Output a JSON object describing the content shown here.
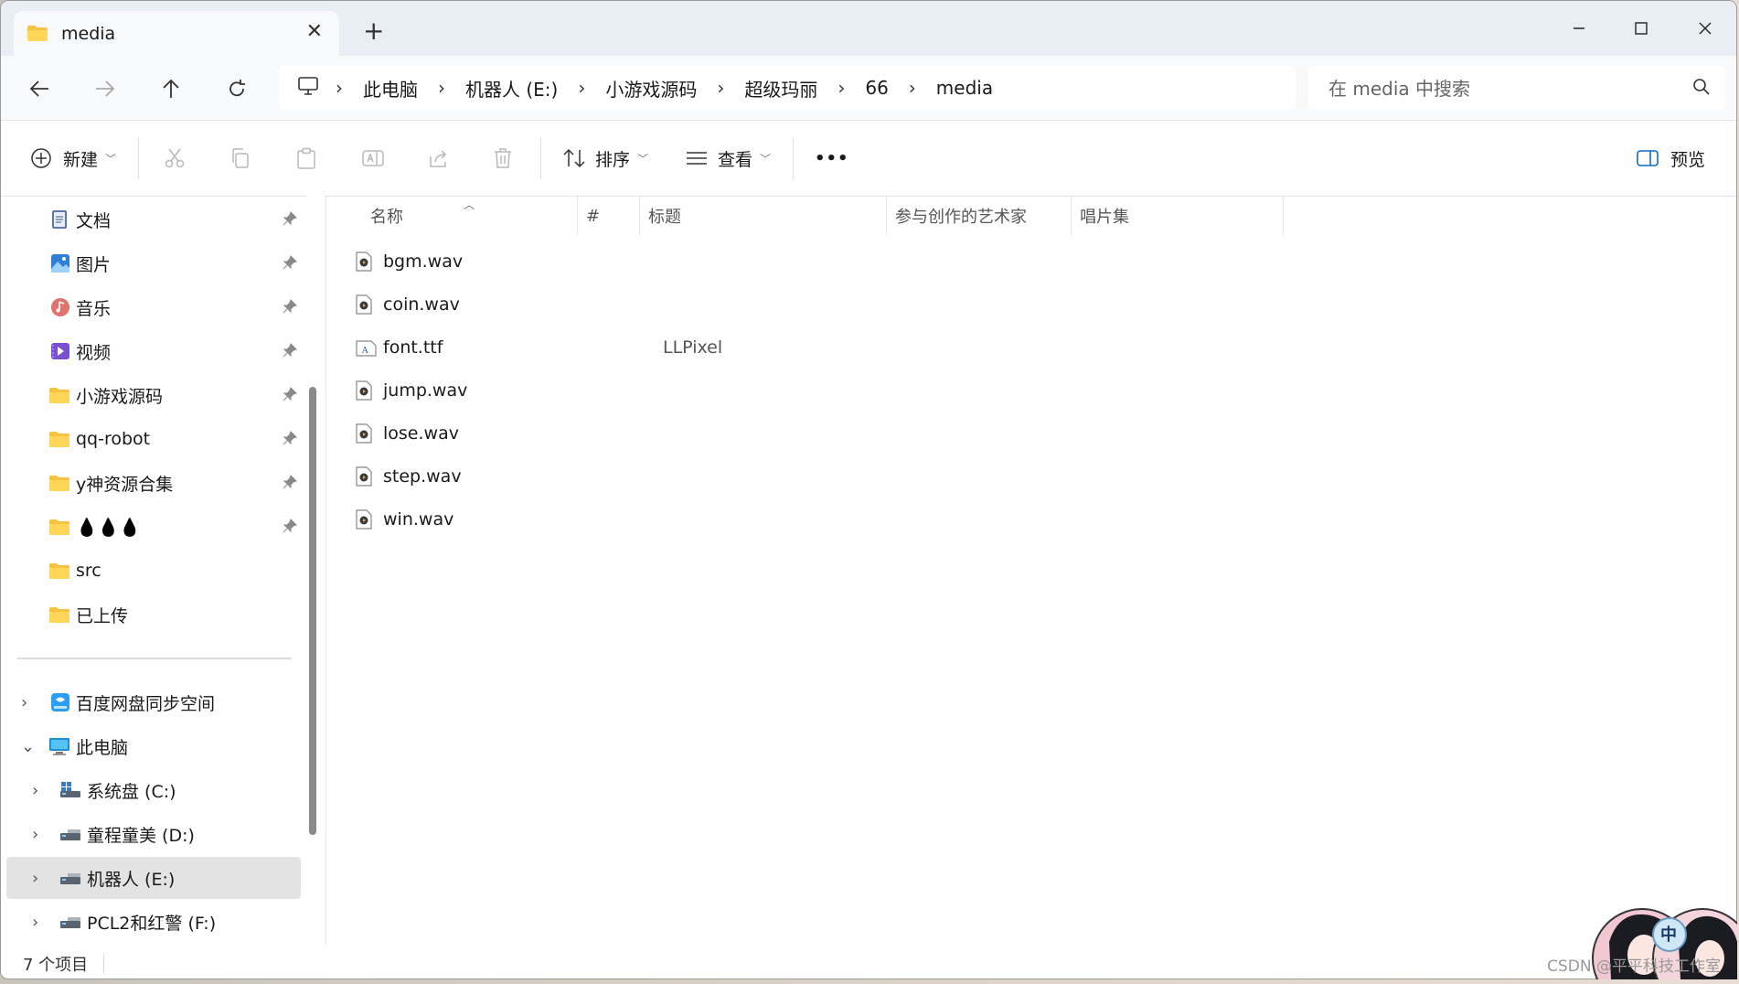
{
  "window": {
    "tab_title": "media",
    "minimize_symbol": "—",
    "maximize_symbol": "☐",
    "close_symbol": "✕"
  },
  "address": {
    "crumbs": [
      "此电脑",
      "机器人 (E:)",
      "小游戏源码",
      "超级玛丽",
      "66",
      "media"
    ],
    "search_placeholder": "在 media 中搜索"
  },
  "toolbar": {
    "new_label": "新建",
    "sort_label": "排序",
    "view_label": "查看",
    "more_label": "•••",
    "preview_label": "预览"
  },
  "sidebar": {
    "quick_access": [
      {
        "label": "文档",
        "icon": "documents-icon"
      },
      {
        "label": "图片",
        "icon": "pictures-icon"
      },
      {
        "label": "音乐",
        "icon": "music-icon"
      },
      {
        "label": "视频",
        "icon": "videos-icon"
      },
      {
        "label": "小游戏源码",
        "icon": "folder-icon"
      },
      {
        "label": "qq-robot",
        "icon": "folder-icon"
      },
      {
        "label": "y神资源合集",
        "icon": "folder-icon"
      },
      {
        "label": "💧💧💧",
        "icon": "folder-icon"
      },
      {
        "label": "src",
        "icon": "folder-icon"
      },
      {
        "label": "已上传",
        "icon": "folder-icon"
      }
    ],
    "tree": [
      {
        "label": "百度网盘同步空间",
        "icon": "baidu-netdisk-icon"
      },
      {
        "label": "此电脑",
        "icon": "computer-icon"
      },
      {
        "label": "系统盘 (C:)",
        "icon": "drive-icon"
      },
      {
        "label": "童程童美 (D:)",
        "icon": "drive-icon"
      },
      {
        "label": "机器人 (E:)",
        "icon": "drive-icon"
      },
      {
        "label": "PCL2和红警 (F:)",
        "icon": "drive-icon"
      }
    ]
  },
  "columns": {
    "name": "名称",
    "number": "#",
    "title": "标题",
    "artists": "参与创作的艺术家",
    "album": "唱片集"
  },
  "files": [
    {
      "name": "bgm.wav",
      "title": "",
      "type": "audio"
    },
    {
      "name": "coin.wav",
      "title": "",
      "type": "audio"
    },
    {
      "name": "font.ttf",
      "title": "LLPixel",
      "type": "font"
    },
    {
      "name": "jump.wav",
      "title": "",
      "type": "audio"
    },
    {
      "name": "lose.wav",
      "title": "",
      "type": "audio"
    },
    {
      "name": "step.wav",
      "title": "",
      "type": "audio"
    },
    {
      "name": "win.wav",
      "title": "",
      "type": "audio"
    }
  ],
  "status": {
    "item_count": "7 个项目",
    "watermark": "CSDN @平平科技工作室",
    "ime_indicator": "中"
  }
}
